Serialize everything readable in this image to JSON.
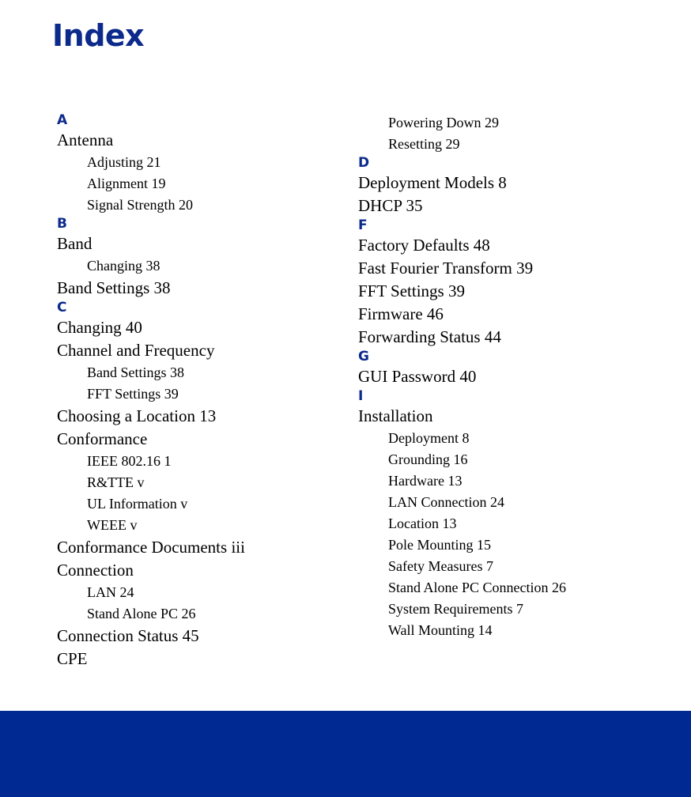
{
  "document": {
    "title": "Index",
    "title_color": "#0c2a8c",
    "footer_band_color": "#002a92",
    "background_color": "#ffffff",
    "text_color": "#000000"
  },
  "columns": [
    {
      "name": "left-column",
      "blocks": [
        {
          "type": "letter",
          "label": "A"
        },
        {
          "type": "entry",
          "label": "Antenna"
        },
        {
          "type": "subentry",
          "label": "Adjusting 21"
        },
        {
          "type": "subentry",
          "label": "Alignment 19"
        },
        {
          "type": "subentry",
          "label": "Signal Strength 20"
        },
        {
          "type": "letter",
          "label": "B"
        },
        {
          "type": "entry",
          "label": "Band"
        },
        {
          "type": "subentry",
          "label": "Changing 38"
        },
        {
          "type": "entry",
          "label": "Band Settings 38"
        },
        {
          "type": "letter",
          "label": "C"
        },
        {
          "type": "entry",
          "label": "Changing 40"
        },
        {
          "type": "entry",
          "label": "Channel and Frequency"
        },
        {
          "type": "subentry",
          "label": "Band Settings 38"
        },
        {
          "type": "subentry",
          "label": "FFT Settings 39"
        },
        {
          "type": "entry",
          "label": "Choosing a Location 13"
        },
        {
          "type": "entry",
          "label": "Conformance"
        },
        {
          "type": "subentry",
          "label": "IEEE 802.16 1"
        },
        {
          "type": "subentry",
          "label": "R&TTE v"
        },
        {
          "type": "subentry",
          "label": "UL Information v"
        },
        {
          "type": "subentry",
          "label": "WEEE v"
        },
        {
          "type": "entry",
          "label": "Conformance Documents iii"
        },
        {
          "type": "entry",
          "label": "Connection"
        },
        {
          "type": "subentry",
          "label": "LAN 24"
        },
        {
          "type": "subentry",
          "label": "Stand Alone PC 26"
        },
        {
          "type": "entry",
          "label": "Connection Status 45"
        },
        {
          "type": "entry",
          "label": "CPE"
        }
      ]
    },
    {
      "name": "right-column",
      "blocks": [
        {
          "type": "subentry",
          "label": "Powering Down 29"
        },
        {
          "type": "subentry",
          "label": "Resetting 29"
        },
        {
          "type": "letter",
          "label": "D"
        },
        {
          "type": "entry",
          "label": "Deployment Models 8"
        },
        {
          "type": "entry",
          "label": "DHCP 35"
        },
        {
          "type": "letter",
          "label": "F"
        },
        {
          "type": "entry",
          "label": "Factory Defaults 48"
        },
        {
          "type": "entry",
          "label": "Fast Fourier Transform 39"
        },
        {
          "type": "entry",
          "label": "FFT Settings 39"
        },
        {
          "type": "entry",
          "label": "Firmware 46"
        },
        {
          "type": "entry",
          "label": "Forwarding Status 44"
        },
        {
          "type": "letter",
          "label": "G"
        },
        {
          "type": "entry",
          "label": "GUI Password 40"
        },
        {
          "type": "letter",
          "label": "I"
        },
        {
          "type": "entry",
          "label": "Installation"
        },
        {
          "type": "subentry",
          "label": "Deployment 8"
        },
        {
          "type": "subentry",
          "label": "Grounding 16"
        },
        {
          "type": "subentry",
          "label": "Hardware 13"
        },
        {
          "type": "subentry",
          "label": "LAN Connection 24"
        },
        {
          "type": "subentry",
          "label": "Location 13"
        },
        {
          "type": "subentry",
          "label": "Pole Mounting 15"
        },
        {
          "type": "subentry",
          "label": "Safety Measures 7"
        },
        {
          "type": "subentry",
          "label": "Stand Alone PC Connection 26"
        },
        {
          "type": "subentry",
          "label": "System Requirements 7"
        },
        {
          "type": "subentry",
          "label": "Wall Mounting 14"
        }
      ]
    }
  ]
}
